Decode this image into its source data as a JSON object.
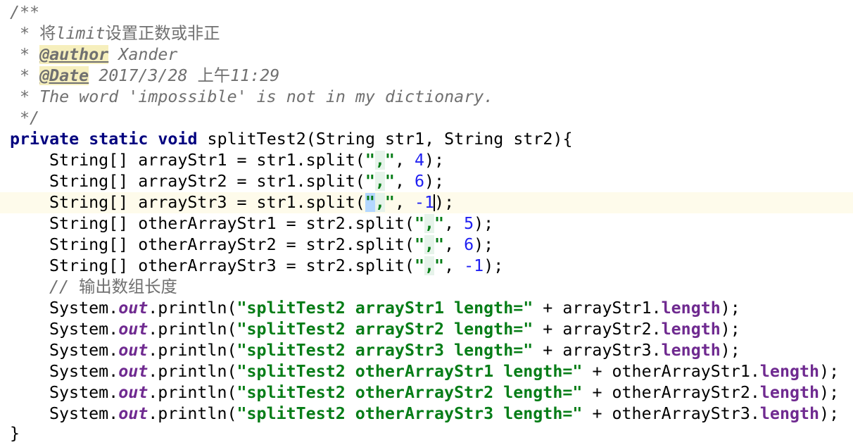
{
  "javadoc": {
    "open": "/**",
    "line1_prefix": " * ",
    "line1_text_a": "将",
    "line1_text_b": "limit",
    "line1_text_c": "设置正数或非正",
    "author_tag": "@author",
    "author_value": " Xander",
    "date_tag": "@Date",
    "date_value_a": " 2017/3/28 ",
    "date_value_b": "上午",
    "date_value_c": "11:29",
    "quote_line": " * The word 'impossible' is not in my dictionary.",
    "close": " */"
  },
  "signature": {
    "kw_private": "private",
    "kw_static": "static",
    "kw_void": "void",
    "rest": " splitTest2(String str1, String str2){"
  },
  "split_lines": [
    {
      "prefix": "String[] arrayStr1 = str1.split(",
      "arg": "4"
    },
    {
      "prefix": "String[] arrayStr2 = str1.split(",
      "arg": "6"
    },
    {
      "prefix": "String[] arrayStr3 = str1.split(",
      "arg": "-1"
    },
    {
      "prefix": "String[] otherArrayStr1 = str2.split(",
      "arg": "5"
    },
    {
      "prefix": "String[] otherArrayStr2 = str2.split(",
      "arg": "6"
    },
    {
      "prefix": "String[] otherArrayStr3 = str2.split(",
      "arg": "-1"
    }
  ],
  "split_quote": "\"",
  "split_comma": ",",
  "split_sep": ", ",
  "split_close": ");",
  "comment_prefix": "// ",
  "comment_text": "输出数组长度",
  "print_lines": [
    {
      "literal": "\"splitTest2 arrayStr1 length=\"",
      "var": "arrayStr1"
    },
    {
      "literal": "\"splitTest2 arrayStr2 length=\"",
      "var": "arrayStr2"
    },
    {
      "literal": "\"splitTest2 arrayStr3 length=\"",
      "var": "arrayStr3"
    },
    {
      "literal": "\"splitTest2 otherArrayStr1 length=\"",
      "var": "otherArrayStr1"
    },
    {
      "literal": "\"splitTest2 otherArrayStr2 length=\"",
      "var": "otherArrayStr2"
    },
    {
      "literal": "\"splitTest2 otherArrayStr3 length=\"",
      "var": "otherArrayStr3"
    }
  ],
  "print_system": "System.",
  "print_out": "out",
  "print_call": ".println(",
  "print_plus": " + ",
  "print_dot": ".",
  "print_length": "length",
  "print_close": ");",
  "closing_brace": "}",
  "colors": {
    "keyword": "#00007f",
    "string": "#067d17",
    "number": "#1f1ff2",
    "comment": "#707070",
    "field": "#6f2a90",
    "current_line": "#fefbeb",
    "paren_match": "#b4d7ff"
  }
}
